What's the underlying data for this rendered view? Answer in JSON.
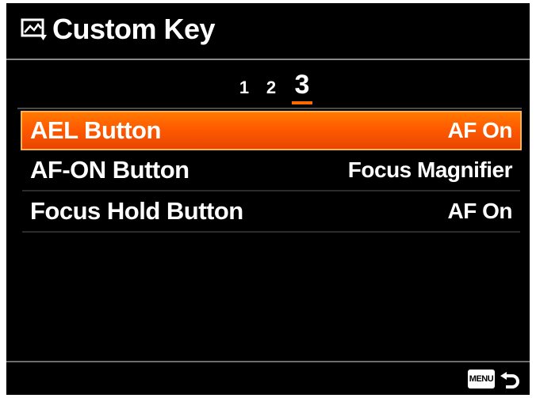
{
  "header": {
    "title": "Custom Key",
    "icon": "camera-settings-icon"
  },
  "page_tabs": {
    "items": [
      "1",
      "2",
      "3"
    ],
    "active": "3"
  },
  "menu": {
    "items": [
      {
        "label": "AEL Button",
        "value": "AF On",
        "selected": true
      },
      {
        "label": "AF-ON Button",
        "value": "Focus Magnifier",
        "selected": false
      },
      {
        "label": "Focus Hold Button",
        "value": "AF On",
        "selected": false
      }
    ]
  },
  "footer": {
    "menu_key_label": "MENU",
    "back_icon": "back-arrow-icon"
  },
  "colors": {
    "accent": "#ff6a00",
    "background": "#000000",
    "text": "#ffffff"
  }
}
